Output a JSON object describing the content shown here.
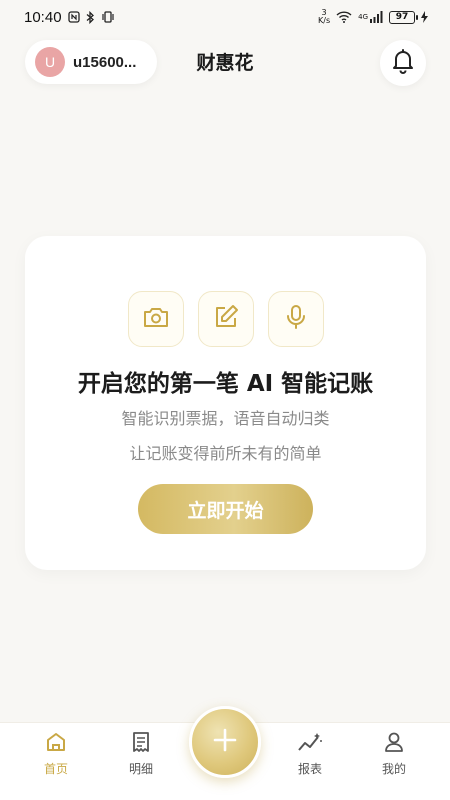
{
  "status_bar": {
    "time": "10:40",
    "speed_value": "3",
    "speed_unit": "K/s",
    "network": "4G",
    "battery": "97"
  },
  "header": {
    "avatar_initial": "U",
    "username": "u15600...",
    "title": "财惠花"
  },
  "card": {
    "title": "开启您的第一笔 AI 智能记账",
    "subtitle1": "智能识别票据，语音自动归类",
    "subtitle2": "让记账变得前所未有的简单",
    "start_button": "立即开始"
  },
  "nav": {
    "home": "首页",
    "detail": "明细",
    "report": "报表",
    "mine": "我的"
  },
  "colors": {
    "accent": "#c9a845",
    "background": "#f8f7f4",
    "avatar": "#e9a5a5"
  },
  "icons": [
    "camera-icon",
    "edit-icon",
    "microphone-icon",
    "bell-icon",
    "home-icon",
    "receipt-icon",
    "chart-icon",
    "user-icon",
    "plus-icon"
  ]
}
